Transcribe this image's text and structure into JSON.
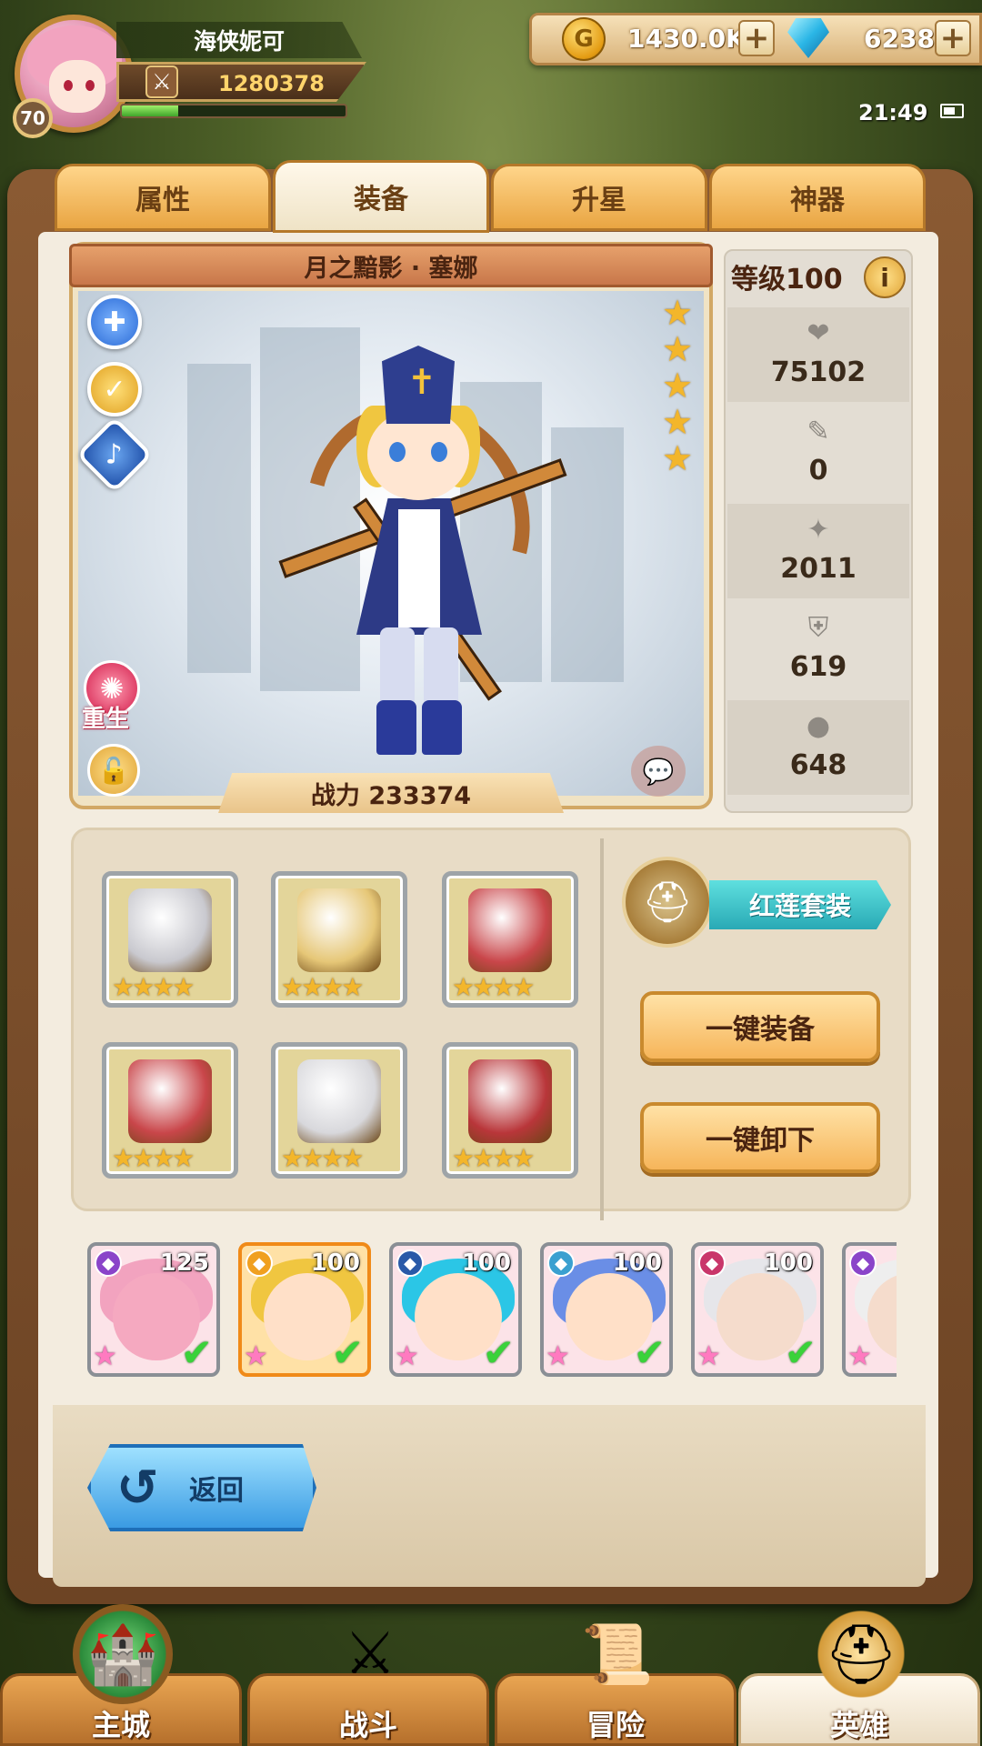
{
  "player": {
    "name": "海侠妮可",
    "level": "70",
    "power": "1280378",
    "xp_progress": 0.25
  },
  "resources": {
    "gold": "1430.0K",
    "gems": "6238",
    "add_symbol": "+"
  },
  "status_bar": {
    "time": "21:49"
  },
  "tabs": [
    {
      "label": "属性",
      "active": false
    },
    {
      "label": "装备",
      "active": true
    },
    {
      "label": "升星",
      "active": false
    },
    {
      "label": "神器",
      "active": false
    }
  ],
  "hero": {
    "title": "月之黯影 · 塞娜",
    "stars": 5,
    "combat_power_label": "战力 233374",
    "rebirth_label": "重生"
  },
  "stats": {
    "level_label": "等级100",
    "info_symbol": "i",
    "values": [
      {
        "icon": "heart-icon",
        "glyph": "❤",
        "value": "75102"
      },
      {
        "icon": "sword-icon",
        "glyph": "✎",
        "value": "0"
      },
      {
        "icon": "dagger-icon",
        "glyph": "✦",
        "value": "2011"
      },
      {
        "icon": "shield-icon",
        "glyph": "⛨",
        "value": "619"
      },
      {
        "icon": "drop-icon",
        "glyph": "●",
        "value": "648"
      }
    ]
  },
  "equipment": {
    "slots": [
      {
        "name": "helmet",
        "stars": "★★★★",
        "color": "#c9c9cf"
      },
      {
        "name": "weapon",
        "stars": "★★★★",
        "color": "#e6c777"
      },
      {
        "name": "armor",
        "stars": "★★★★",
        "color": "#c9464a"
      },
      {
        "name": "gloves",
        "stars": "★★★★",
        "color": "#c9464a"
      },
      {
        "name": "boots",
        "stars": "★★★★",
        "color": "#d8d8dc"
      },
      {
        "name": "accessory",
        "stars": "★★★★",
        "color": "#b9363a"
      }
    ],
    "set_name": "红莲套装",
    "equip_all": "一键装备",
    "unequip_all": "一键卸下"
  },
  "roster": [
    {
      "level": "125",
      "face": "#f5a9c0",
      "hair": "#f2a3bf",
      "class_color": "#8a44c9",
      "selected": false
    },
    {
      "level": "100",
      "face": "#ffe0c8",
      "hair": "#f0c640",
      "class_color": "#f0a020",
      "selected": true
    },
    {
      "level": "100",
      "face": "#ffe0c8",
      "hair": "#2bc6e6",
      "class_color": "#2a5aa8",
      "selected": false
    },
    {
      "level": "100",
      "face": "#ffe0c8",
      "hair": "#6a8ee6",
      "class_color": "#3aa0d0",
      "selected": false
    },
    {
      "level": "100",
      "face": "#f5dccc",
      "hair": "#e6e6ea",
      "class_color": "#c9366a",
      "selected": false
    },
    {
      "level": "",
      "face": "#f5dccc",
      "hair": "#eeeeee",
      "class_color": "#8a44c9",
      "selected": false
    }
  ],
  "back_button": {
    "label": "返回"
  },
  "bottom_nav": [
    {
      "label": "主城",
      "icon": "castle-icon",
      "active": false
    },
    {
      "label": "战斗",
      "icon": "crossed-swords-icon",
      "active": false
    },
    {
      "label": "冒险",
      "icon": "map-scroll-icon",
      "active": false
    },
    {
      "label": "英雄",
      "icon": "hero-helmet-icon",
      "active": true
    }
  ],
  "colors": {
    "tab_active": "#f4ead6",
    "tab_inactive": "#f2b35a",
    "set_ribbon": "#3fc3c8",
    "gold_text": "#ffd46b"
  }
}
